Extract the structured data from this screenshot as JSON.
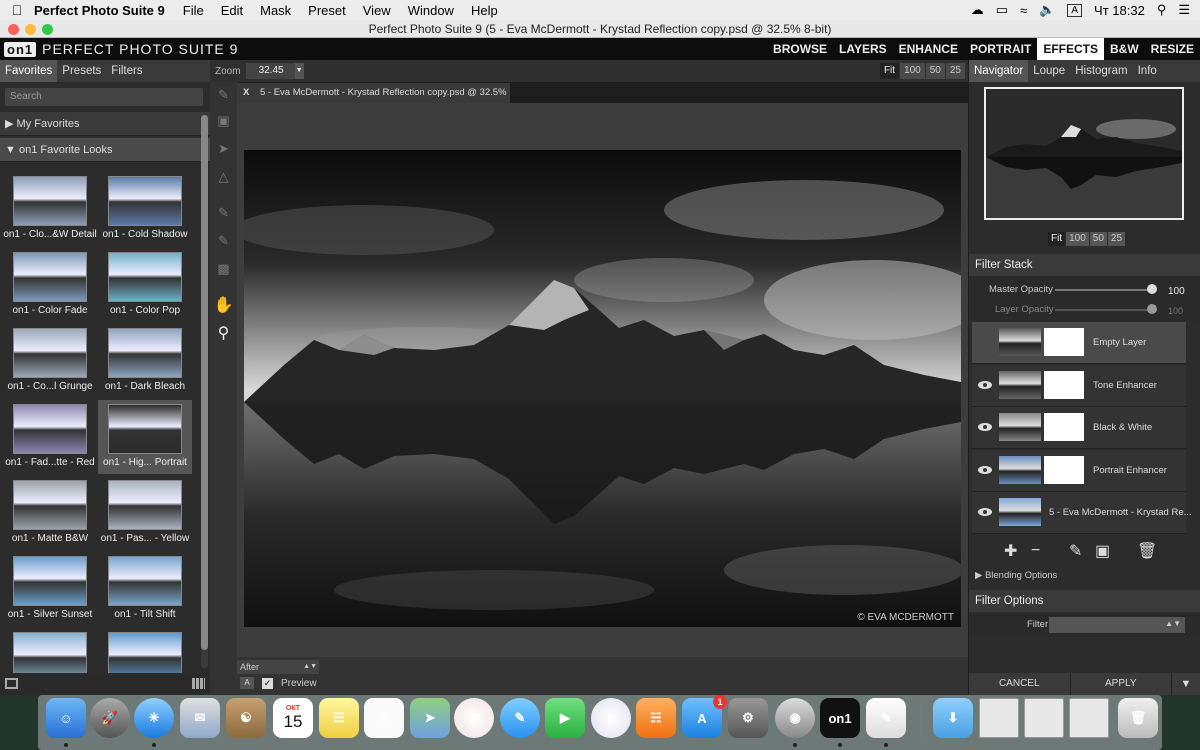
{
  "menubar": {
    "app_name": "Perfect Photo Suite 9",
    "items": [
      "File",
      "Edit",
      "Mask",
      "Preset",
      "View",
      "Window",
      "Help"
    ],
    "input_source": "A",
    "clock": "Чт 18:32"
  },
  "window": {
    "title": "Perfect Photo Suite 9 (5 - Eva McDermott - Krystad Reflection copy.psd @ 32.5% 8-bit)"
  },
  "appbar": {
    "logo_mark": "on1",
    "logo_text": "PERFECT PHOTO SUITE 9",
    "modules": [
      "BROWSE",
      "LAYERS",
      "ENHANCE",
      "PORTRAIT",
      "EFFECTS",
      "B&W",
      "RESIZE"
    ],
    "active_module": "EFFECTS"
  },
  "left": {
    "tabs": [
      "Favorites",
      "Presets",
      "Filters"
    ],
    "active_tab": "Favorites",
    "search_placeholder": "Search",
    "sections": [
      "My Favorites",
      "on1 Favorite Looks"
    ],
    "looks": [
      "on1 - Clo...&W Detail",
      "on1 - Cold Shadow",
      "on1 - Color Fade",
      "on1 - Color Pop",
      "on1 - Co...l Grunge",
      "on1 - Dark Bleach",
      "on1 - Fad...tte - Red",
      "on1 - Hig... Portrait",
      "on1 - Matte B&W",
      "on1 - Pas... - Yellow",
      "on1 - Silver Sunset",
      "on1 - Tilt Shift"
    ],
    "selected_look": "on1 - Hig... Portrait"
  },
  "canvas": {
    "zoom_label": "Zoom",
    "zoom_value": "32.45",
    "fit_buttons": [
      "Fit",
      "100",
      "50",
      "25"
    ],
    "doc_tab_close": "X",
    "doc_tab": "5 - Eva McDermott - Krystad Reflection copy.psd @ 32.5% 8-bit",
    "watermark": "© EVA MCDERMOTT",
    "view_mode": "After",
    "preview_label": "Preview",
    "a_button": "A"
  },
  "right": {
    "tabs": [
      "Navigator",
      "Loupe",
      "Histogram",
      "Info"
    ],
    "active_tab": "Navigator",
    "nav_fit": [
      "Fit",
      "100",
      "50",
      "25"
    ],
    "filter_stack_title": "Filter Stack",
    "master_opacity_label": "Master Opacity",
    "master_opacity_value": "100",
    "layer_opacity_label": "Layer Opacity",
    "layer_opacity_value": "100",
    "layers": [
      "Empty Layer",
      "Tone Enhancer",
      "Black & White",
      "Portrait Enhancer",
      "5 - Eva McDermott - Krystad Re..."
    ],
    "blending_options": "Blending Options",
    "filter_options_title": "Filter Options",
    "filter_label": "Filter",
    "cancel": "CANCEL",
    "apply": "APPLY"
  },
  "dock": {
    "calendar_month": "ОКТ",
    "calendar_day": "15",
    "appstore_badge": "1",
    "apps": [
      "Finder",
      "Launchpad",
      "Safari",
      "Mail",
      "Contacts",
      "Calendar",
      "Notes",
      "Reminders",
      "Maps",
      "Photos",
      "Messages",
      "FaceTime",
      "iTunes",
      "iBooks",
      "App Store",
      "System Preferences",
      "Perfect Photo Suite 9 Browse",
      "on1",
      "TextEdit",
      "Downloads",
      "Window 1",
      "Window 2",
      "Window 3",
      "Trash"
    ]
  },
  "colors": {
    "panel_bg": "#2c2c2c",
    "header_bg": "#3a3a3a",
    "active_module_bg": "#ffffff",
    "accent_blue": "#4a7fc1"
  }
}
